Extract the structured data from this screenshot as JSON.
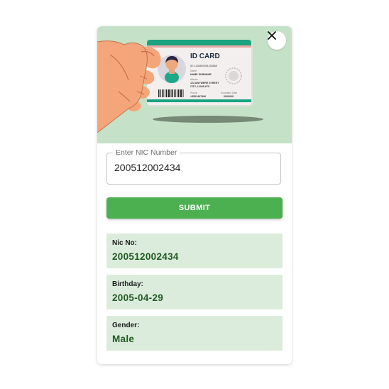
{
  "hero": {
    "card_title": "ID CARD",
    "card_id": "ID: 1234567891234568",
    "name_label": "Name",
    "name_value": "NAME SURNAME",
    "address_label": "Adress",
    "address_line1": "123 ANYWERE STREET",
    "address_line2": "CITY, 12345-675",
    "phone_label": "Phone",
    "phone_value": "+5551467896",
    "expiration_label": "Expiration Date",
    "expiration_value": "00/00/00"
  },
  "form": {
    "nic_label": "Enter NIC Number",
    "nic_value": "200512002434",
    "submit_label": "SUBMIT"
  },
  "results": {
    "nic": {
      "label": "Nic No:",
      "value": "200512002434"
    },
    "birthday": {
      "label": "Birthday:",
      "value": "2005-04-29"
    },
    "gender": {
      "label": "Gender:",
      "value": "Male"
    }
  },
  "colors": {
    "accent": "#4caf50",
    "hero_bg": "#c5e1c7",
    "result_bg": "#dcecdc",
    "result_text": "#1e5a22"
  }
}
